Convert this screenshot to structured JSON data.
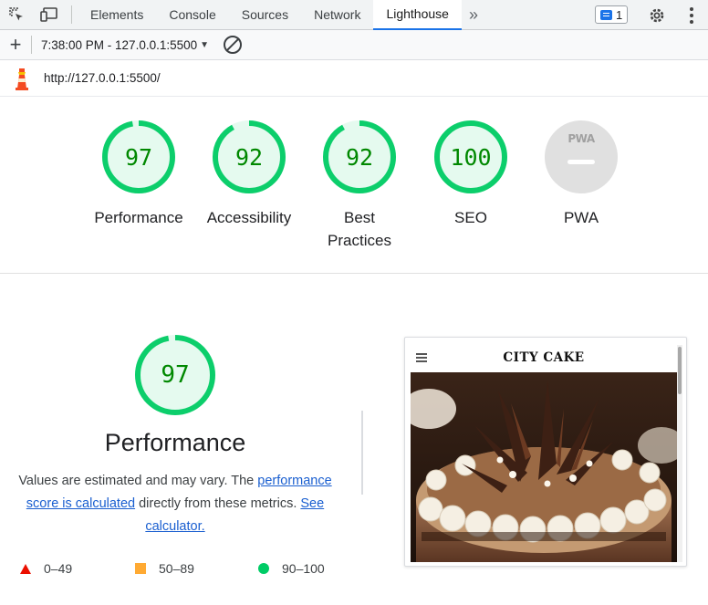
{
  "devtools": {
    "tabs": [
      {
        "label": "Elements"
      },
      {
        "label": "Console"
      },
      {
        "label": "Sources"
      },
      {
        "label": "Network"
      },
      {
        "label": "Lighthouse"
      }
    ],
    "active_tab": "Lighthouse",
    "more_tabs": "»",
    "issues_count": "1"
  },
  "toolbar": {
    "report_label": "7:38:00 PM - 127.0.0.1:5500",
    "add_label": "+"
  },
  "url": "http://127.0.0.1:5500/",
  "categories": [
    {
      "label": "Performance",
      "score": "97",
      "value": 97
    },
    {
      "label": "Accessibility",
      "score": "92",
      "value": 92
    },
    {
      "label": "Best Practices",
      "score": "92",
      "value": 92
    },
    {
      "label": "SEO",
      "score": "100",
      "value": 100
    },
    {
      "label": "PWA",
      "score": "",
      "value": null,
      "badge": "PWA"
    }
  ],
  "performance": {
    "score": "97",
    "value": 97,
    "title": "Performance",
    "desc_prefix": "Values are estimated and may vary. The ",
    "link_score": "performance score is calculated",
    "desc_middle": " directly from these metrics. ",
    "link_calculator": "See calculator.",
    "legend": [
      {
        "range": "0–49",
        "color": "#eb0f00"
      },
      {
        "range": "50–89",
        "color": "#ffaa33"
      },
      {
        "range": "90–100",
        "color": "#00cc66"
      }
    ]
  },
  "screenshot": {
    "brand": "CITY CAKE"
  },
  "colors": {
    "pass": "#0cce6b",
    "pass_text": "#008800",
    "pass_fill": "#e5faef",
    "accent": "#1a73e8",
    "pwa_gray": "#e0e0e0"
  }
}
